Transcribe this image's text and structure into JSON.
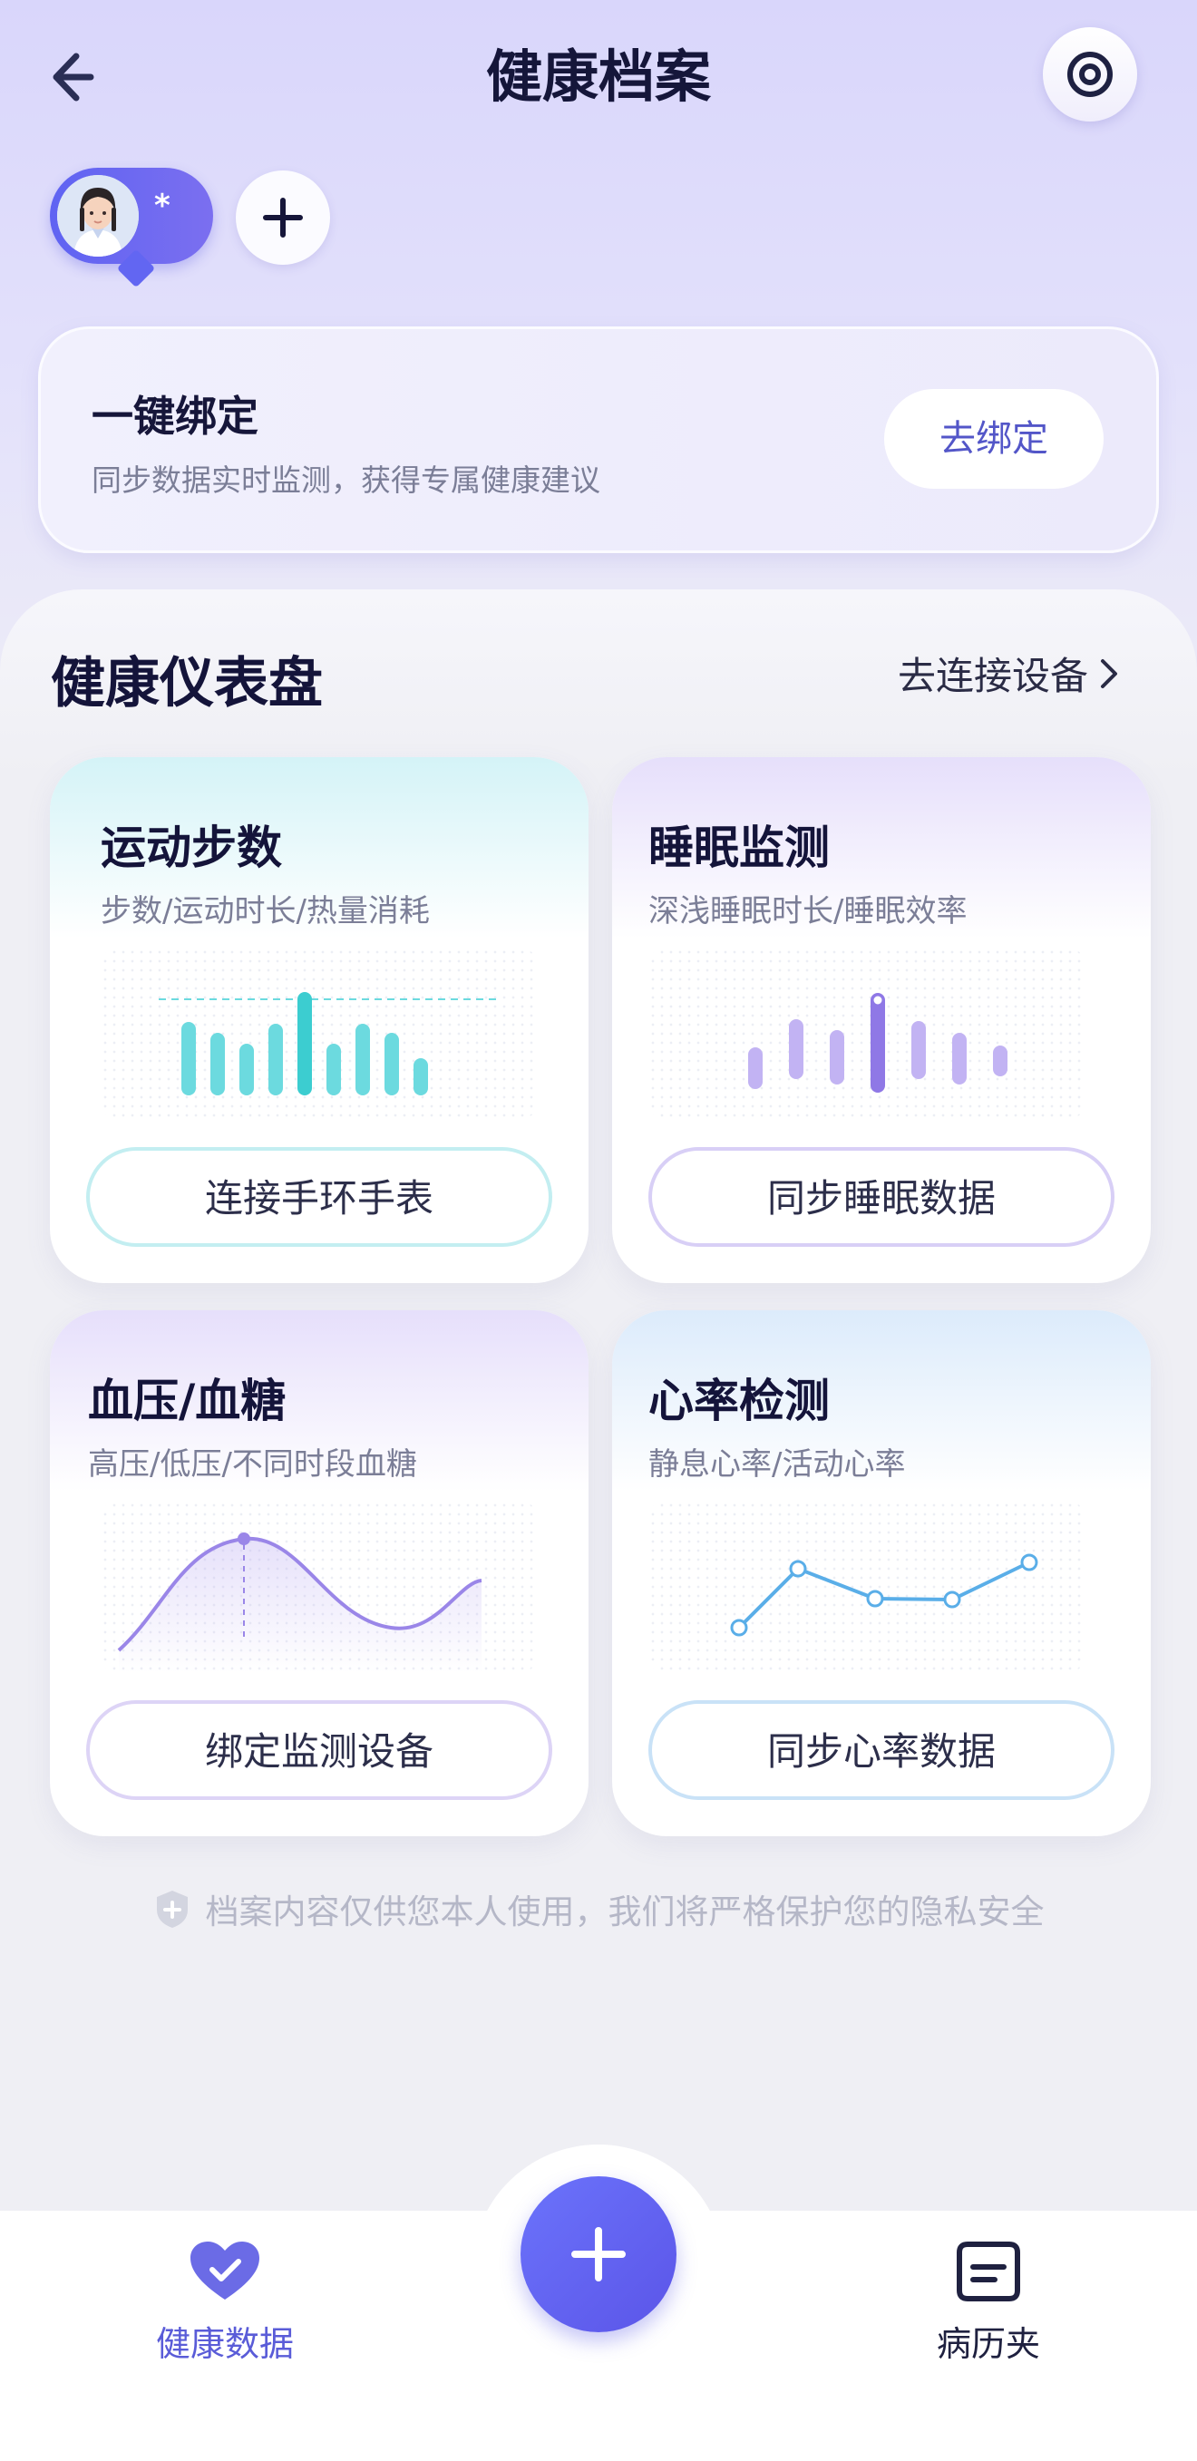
{
  "header": {
    "title": "健康档案"
  },
  "profile": {
    "name": "*"
  },
  "bind_card": {
    "title": "一键绑定",
    "subtitle": "同步数据实时监测，获得专属健康建议",
    "button": "去绑定"
  },
  "dashboard": {
    "title": "健康仪表盘",
    "connect_link": "去连接设备"
  },
  "cards": [
    {
      "title": "运动步数",
      "subtitle": "步数/运动时长/热量消耗",
      "button": "连接手环手表",
      "accent": "#4fd6dc"
    },
    {
      "title": "睡眠监测",
      "subtitle": "深浅睡眠时长/睡眠效率",
      "button": "同步睡眠数据",
      "accent": "#9d8af0"
    },
    {
      "title": "血压/血糖",
      "subtitle": "高压/低压/不同时段血糖",
      "button": "绑定监测设备",
      "accent": "#9a86e8"
    },
    {
      "title": "心率检测",
      "subtitle": "静息心率/活动心率",
      "button": "同步心率数据",
      "accent": "#5aaee8"
    }
  ],
  "footer_note": "档案内容仅供您本人使用，我们将严格保护您的隐私安全",
  "nav": {
    "health_data": "健康数据",
    "records": "病历夹"
  },
  "colors": {
    "primary": "#5d5fef",
    "nav_active": "#5a5cd8"
  }
}
